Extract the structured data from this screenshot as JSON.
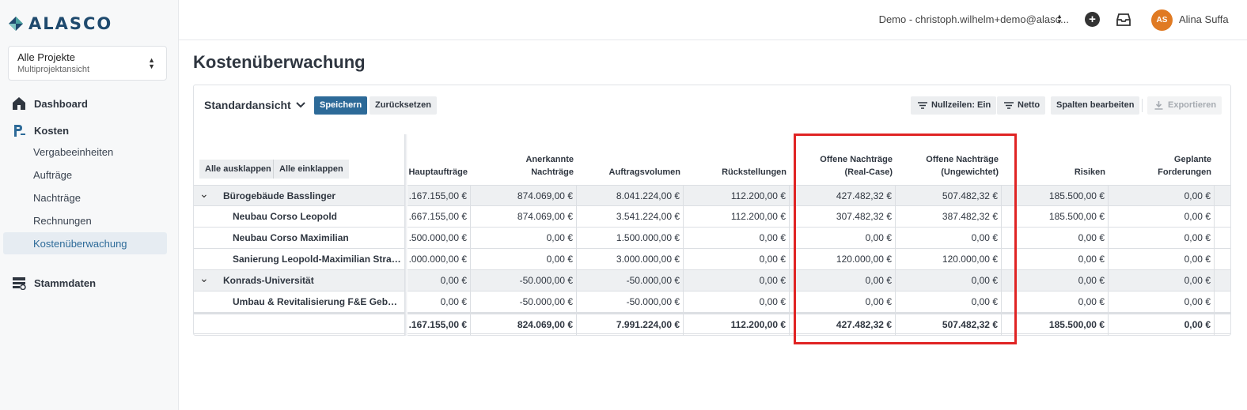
{
  "app": {
    "logo_text": "ALASCO"
  },
  "project_selector": {
    "title": "Alle Projekte",
    "subtitle": "Multiprojektansicht"
  },
  "sidebar": {
    "dashboard": "Dashboard",
    "kosten": "Kosten",
    "sub_items": [
      "Vergabeeinheiten",
      "Aufträge",
      "Nachträge",
      "Rechnungen",
      "Kostenüberwachung"
    ],
    "active_sub": "Kostenüberwachung",
    "stammdaten": "Stammdaten"
  },
  "topbar": {
    "account": "Demo - christoph.wilhelm+demo@alasc...",
    "avatar_initials": "AS",
    "user_name": "Alina Suffa"
  },
  "page": {
    "title": "Kostenüberwachung"
  },
  "toolbar": {
    "view": "Standardansicht",
    "save": "Speichern",
    "reset": "Zurücksetzen",
    "zero_rows": "Nullzeilen: Ein",
    "net": "Netto",
    "edit_columns": "Spalten bearbeiten",
    "export": "Exportieren"
  },
  "table": {
    "expand_all": "Alle ausklappen",
    "collapse_all": "Alle einklappen",
    "headers": [
      [
        "Hauptaufträge"
      ],
      [
        "Anerkannte",
        "Nachträge"
      ],
      [
        "Auftragsvolumen"
      ],
      [
        "Rückstellungen"
      ],
      [
        "Offene Nachträge",
        "(Real-Case)"
      ],
      [
        "Offene Nachträge",
        "(Ungewichtet)"
      ],
      [
        "Risiken"
      ],
      [
        "Geplante",
        "Forderungen"
      ]
    ],
    "rows": [
      {
        "name": "Bürogebäude Basslinger",
        "group": true,
        "values": [
          ".167.155,00 €",
          "874.069,00 €",
          "8.041.224,00 €",
          "112.200,00 €",
          "427.482,32 €",
          "507.482,32 €",
          "185.500,00 €",
          "0,00 €"
        ]
      },
      {
        "name": "Neubau Corso Leopold",
        "group": false,
        "values": [
          ".667.155,00 €",
          "874.069,00 €",
          "3.541.224,00 €",
          "112.200,00 €",
          "307.482,32 €",
          "387.482,32 €",
          "185.500,00 €",
          "0,00 €"
        ]
      },
      {
        "name": "Neubau Corso Maximilian",
        "group": false,
        "values": [
          ".500.000,00 €",
          "0,00 €",
          "1.500.000,00 €",
          "0,00 €",
          "0,00 €",
          "0,00 €",
          "0,00 €",
          "0,00 €"
        ]
      },
      {
        "name": "Sanierung Leopold-Maximilian Straß...",
        "group": false,
        "values": [
          ".000.000,00 €",
          "0,00 €",
          "3.000.000,00 €",
          "0,00 €",
          "120.000,00 €",
          "120.000,00 €",
          "0,00 €",
          "0,00 €"
        ]
      },
      {
        "name": "Konrads-Universität",
        "group": true,
        "values": [
          "0,00 €",
          "-50.000,00 €",
          "-50.000,00 €",
          "0,00 €",
          "0,00 €",
          "0,00 €",
          "0,00 €",
          "0,00 €"
        ]
      },
      {
        "name": "Umbau & Revitalisierung F&E Gebäu...",
        "group": false,
        "values": [
          "0,00 €",
          "-50.000,00 €",
          "-50.000,00 €",
          "0,00 €",
          "0,00 €",
          "0,00 €",
          "0,00 €",
          "0,00 €"
        ]
      }
    ],
    "totals": [
      ".167.155,00 €",
      "824.069,00 €",
      "7.991.224,00 €",
      "112.200,00 €",
      "427.482,32 €",
      "507.482,32 €",
      "185.500,00 €",
      "0,00 €"
    ]
  },
  "colors": {
    "primary": "#2d6a98",
    "highlight": "#e02424",
    "avatar": "#e07a23"
  }
}
